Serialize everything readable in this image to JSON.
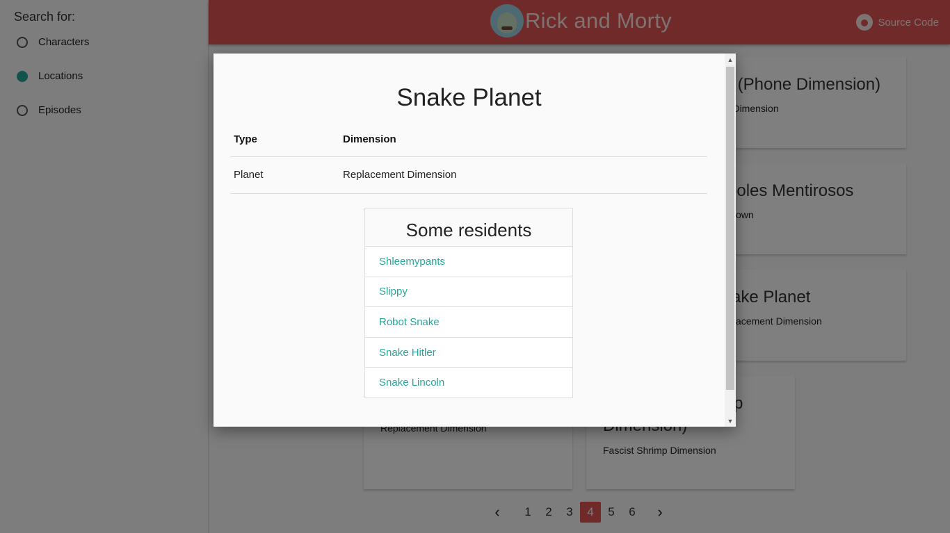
{
  "sidebar": {
    "heading": "Search for:",
    "options": [
      {
        "label": "Characters",
        "checked": false
      },
      {
        "label": "Locations",
        "checked": true
      },
      {
        "label": "Episodes",
        "checked": false
      }
    ]
  },
  "header": {
    "title": "Rick and Morty",
    "source_label": "Source Code"
  },
  "background_cards": [
    {
      "title": "th (Phone Dimension)",
      "sub": "ne Dimension"
    },
    {
      "title": "boles Mentirosos",
      "sub": "own"
    },
    {
      "title": "ake Planet",
      "sub": "acement Dimension"
    },
    {
      "title": "Replacement Dimension",
      "sub": ""
    },
    {
      "title": "p",
      "title2": "Dimension)",
      "sub": "Fascist Shrimp Dimension"
    }
  ],
  "pagination": {
    "prev": "‹",
    "next": "›",
    "pages": [
      "1",
      "2",
      "3",
      "4",
      "5",
      "6"
    ],
    "active": "4"
  },
  "modal": {
    "title": "Snake Planet",
    "table": {
      "headers": [
        "Type",
        "Dimension"
      ],
      "row": [
        "Planet",
        "Replacement Dimension"
      ]
    },
    "residents_title": "Some residents",
    "residents": [
      "Shleemypants",
      "Slippy",
      "Robot Snake",
      "Snake Hitler",
      "Snake Lincoln"
    ]
  },
  "colors": {
    "header": "#e05555",
    "accent": "#26a69a"
  }
}
